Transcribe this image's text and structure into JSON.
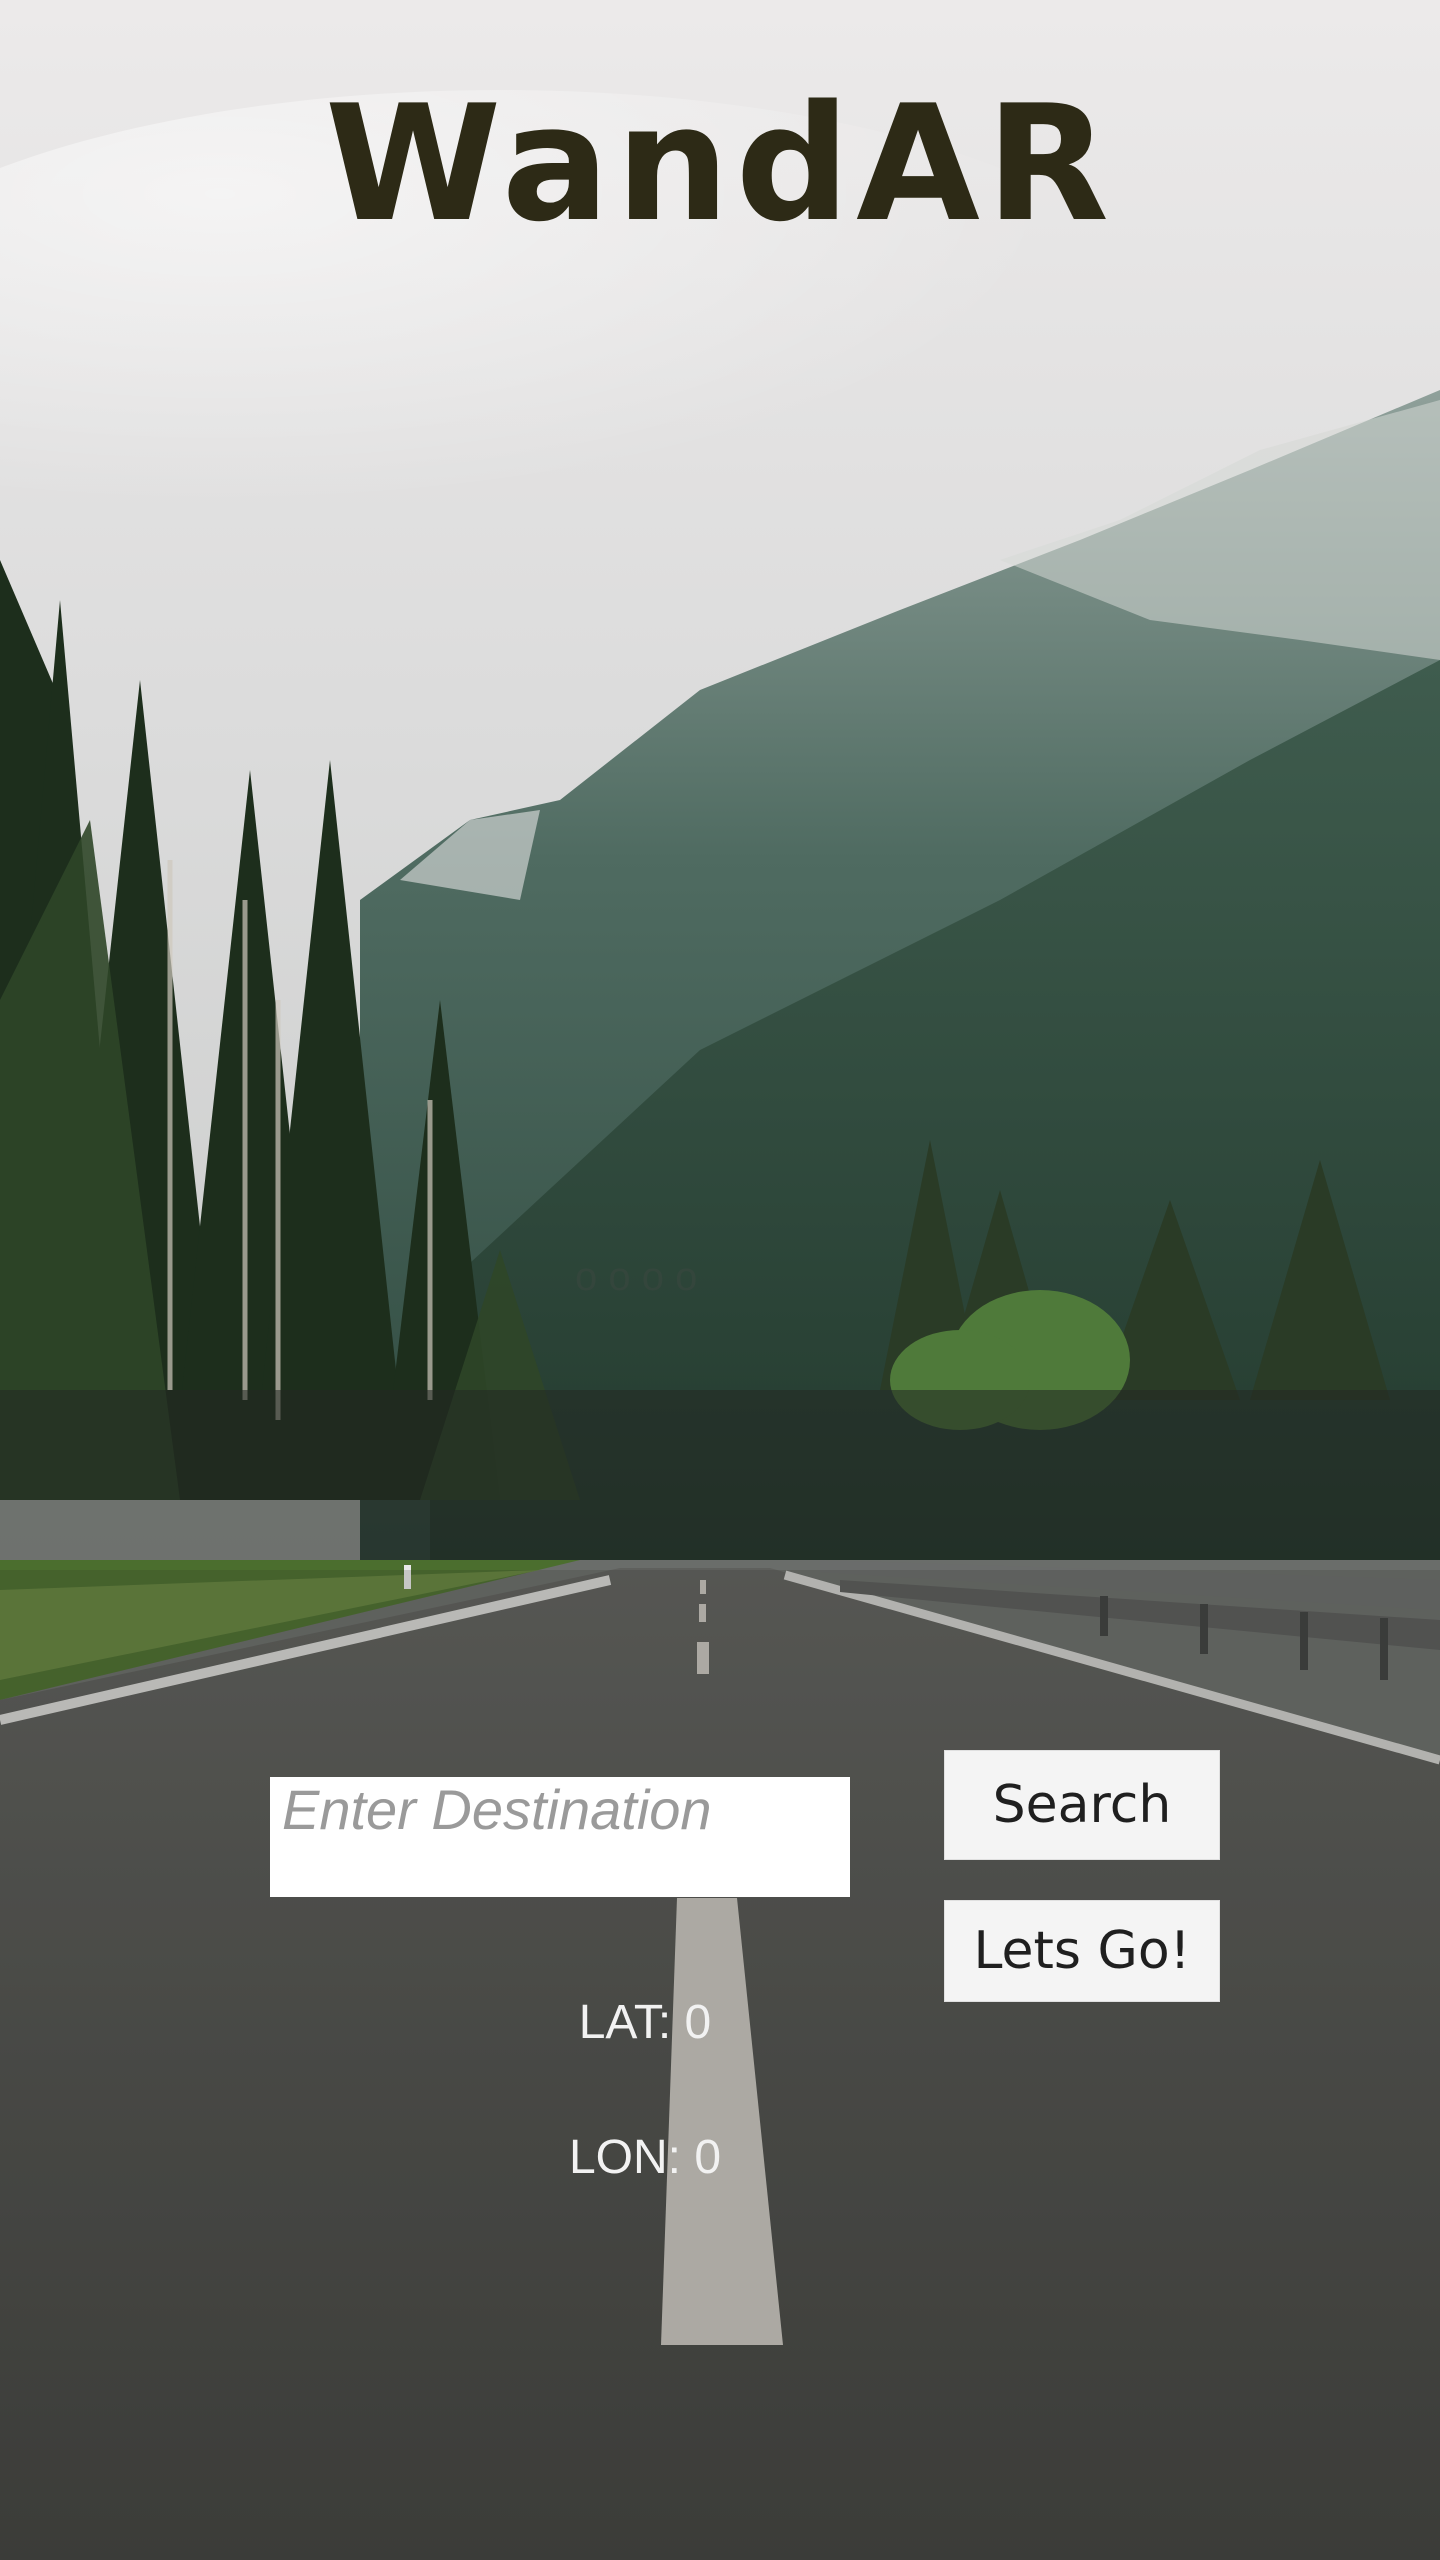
{
  "app": {
    "title": "WandAR"
  },
  "background": {
    "faint_text": "o o o o"
  },
  "search": {
    "placeholder": "Enter Destination",
    "value": "",
    "search_label": "Search",
    "go_label": "Lets Go!"
  },
  "location": {
    "lat_label": "LAT: 0",
    "lon_label": "LON: 0"
  },
  "colors": {
    "title": "#2d2a16",
    "button_bg": "#f4f4f4",
    "coord_text": "#f2f2f2"
  }
}
